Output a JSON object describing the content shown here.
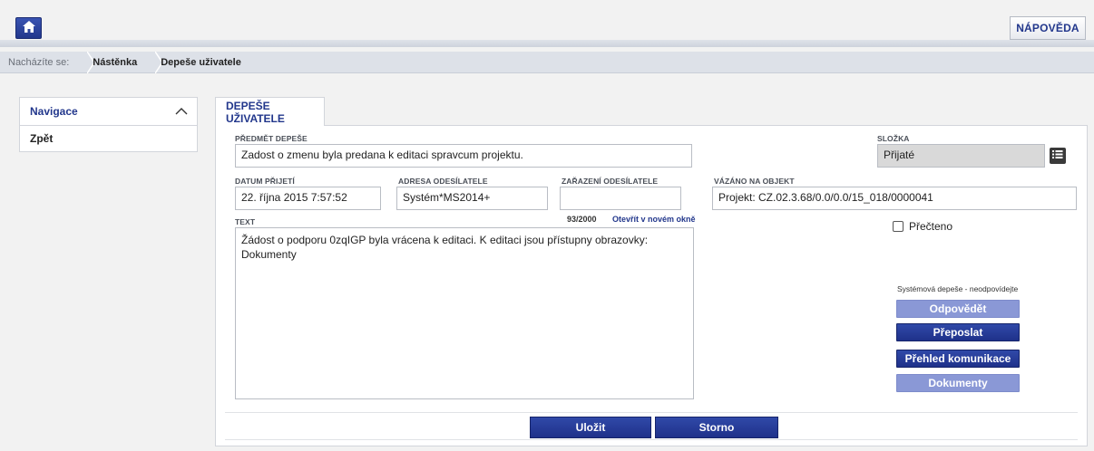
{
  "header": {
    "home_icon": "home-icon",
    "help_label": "NÁPOVĚDA"
  },
  "breadcrumb": {
    "prefix": "Nacházíte se:",
    "items": [
      "Nástěnka",
      "Depeše uživatele"
    ]
  },
  "nav": {
    "title": "Navigace",
    "collapse_icon": "chevron-up-icon",
    "items": [
      "Zpět"
    ]
  },
  "tab": {
    "label": "DEPEŠE UŽIVATELE"
  },
  "form": {
    "subject_label": "PŘEDMĚT DEPEŠE",
    "subject_value": "Zadost o zmenu byla predana k editaci spravcum projektu.",
    "folder_label": "SLOŽKA",
    "folder_value": "Přijaté",
    "folder_icon": "list-icon",
    "received_label": "DATUM PŘIJETÍ",
    "received_value": "22. října 2015 7:57:52",
    "sender_label": "ADRESA ODESÍLATELE",
    "sender_value": "Systém*MS2014+",
    "sender_role_label": "ZAŘAZENÍ ODESÍLATELE",
    "sender_role_value": "",
    "bound_label": "VÁZÁNO NA OBJEKT",
    "bound_value": "Projekt: CZ.02.3.68/0.0/0.0/15_018/0000041",
    "text_label": "TEXT",
    "text_counter": "93/2000",
    "open_new_window": "Otevřít v novém okně",
    "text_value": "Žádost o podporu 0zqIGP byla vrácena k editaci. K editaci jsou přístupny obrazovky: Dokumenty",
    "read_label": "Přečteno",
    "read_checked": false
  },
  "actions": {
    "system_note": "Systémová depeše - neodpovídejte",
    "reply": "Odpovědět",
    "forward": "Přeposlat",
    "overview": "Přehled komunikace",
    "documents": "Dokumenty"
  },
  "footer": {
    "save": "Uložit",
    "cancel": "Storno"
  },
  "colors": {
    "brand_blue": "#22378c",
    "button_active": "#1f318a",
    "button_inactive": "#8a98d6",
    "disabled_field": "#d9d9d9"
  }
}
